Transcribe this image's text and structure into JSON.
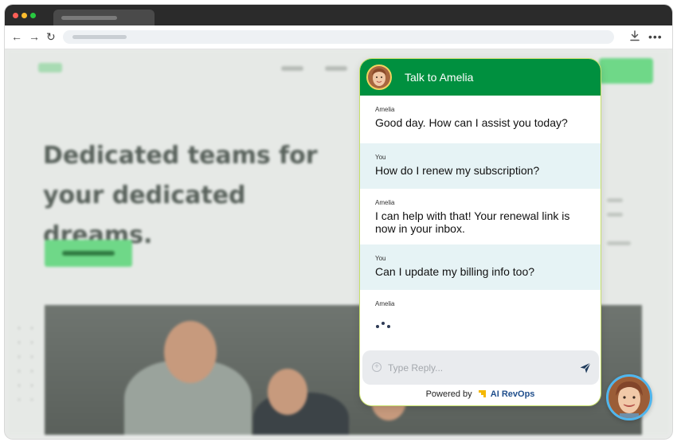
{
  "browser": {
    "tab_title": "",
    "address": ""
  },
  "website": {
    "hero_heading": "Dedicated teams for your dedicated dreams."
  },
  "chat": {
    "title": "Talk to Amelia",
    "colors": {
      "header": "#00903f",
      "border": "#c7e06a",
      "user_message_bg": "#e6f3f5",
      "brand": "#1f4e8c"
    },
    "messages": [
      {
        "sender": "Amelia",
        "text": "Good day. How can I assist you today?",
        "role": "agent"
      },
      {
        "sender": "You",
        "text": "How do I renew my subscription?",
        "role": "user"
      },
      {
        "sender": "Amelia",
        "text": "I can help with that! Your renewal link is now in your inbox.",
        "role": "agent"
      },
      {
        "sender": "You",
        "text": "Can I update my billing info too?",
        "role": "user"
      }
    ],
    "typing": {
      "sender": "Amelia"
    },
    "input": {
      "placeholder": "Type Reply...",
      "value": ""
    },
    "footer": {
      "powered_by": "Powered by",
      "brand": "AI RevOps"
    },
    "icons": {
      "attach": "plus-circle-icon",
      "send": "send-icon"
    }
  }
}
